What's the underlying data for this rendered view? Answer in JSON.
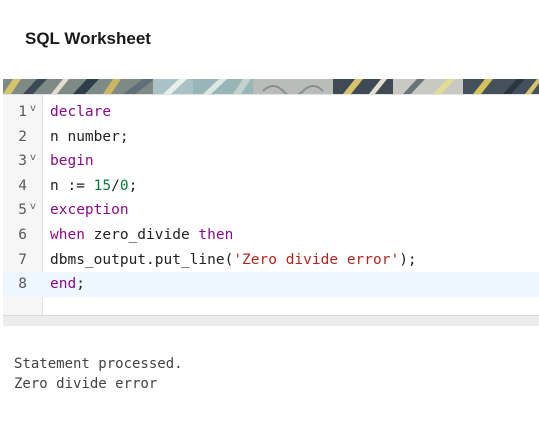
{
  "header": {
    "title": "SQL Worksheet"
  },
  "editor": {
    "lines": [
      {
        "number": "1",
        "foldable": true,
        "tokens": [
          {
            "text": "declare",
            "type": "kw"
          }
        ]
      },
      {
        "number": "2",
        "foldable": false,
        "tokens": [
          {
            "text": "n number;",
            "type": "plain"
          }
        ]
      },
      {
        "number": "3",
        "foldable": true,
        "tokens": [
          {
            "text": "begin",
            "type": "kw"
          }
        ]
      },
      {
        "number": "4",
        "foldable": false,
        "tokens": [
          {
            "text": "n := ",
            "type": "plain"
          },
          {
            "text": "15",
            "type": "num"
          },
          {
            "text": "/",
            "type": "plain"
          },
          {
            "text": "0",
            "type": "num"
          },
          {
            "text": ";",
            "type": "plain"
          }
        ]
      },
      {
        "number": "5",
        "foldable": true,
        "tokens": [
          {
            "text": "exception",
            "type": "kw"
          }
        ]
      },
      {
        "number": "6",
        "foldable": false,
        "tokens": [
          {
            "text": "when",
            "type": "kw"
          },
          {
            "text": " zero_divide ",
            "type": "plain"
          },
          {
            "text": "then",
            "type": "kw"
          }
        ]
      },
      {
        "number": "7",
        "foldable": false,
        "tokens": [
          {
            "text": "dbms_output.put_line(",
            "type": "plain"
          },
          {
            "text": "'Zero divide error'",
            "type": "str"
          },
          {
            "text": ");",
            "type": "plain"
          }
        ]
      },
      {
        "number": "8",
        "foldable": false,
        "active": true,
        "tokens": [
          {
            "text": "end",
            "type": "kw"
          },
          {
            "text": ";",
            "type": "plain"
          }
        ]
      }
    ],
    "fold_glyph": "v"
  },
  "output": {
    "lines": [
      "Statement processed.",
      "Zero divide error"
    ]
  },
  "colors": {
    "keyword": "#8a0a8a",
    "number": "#0b7a3e",
    "string": "#b3261e",
    "active_line": "#eef6ff"
  }
}
